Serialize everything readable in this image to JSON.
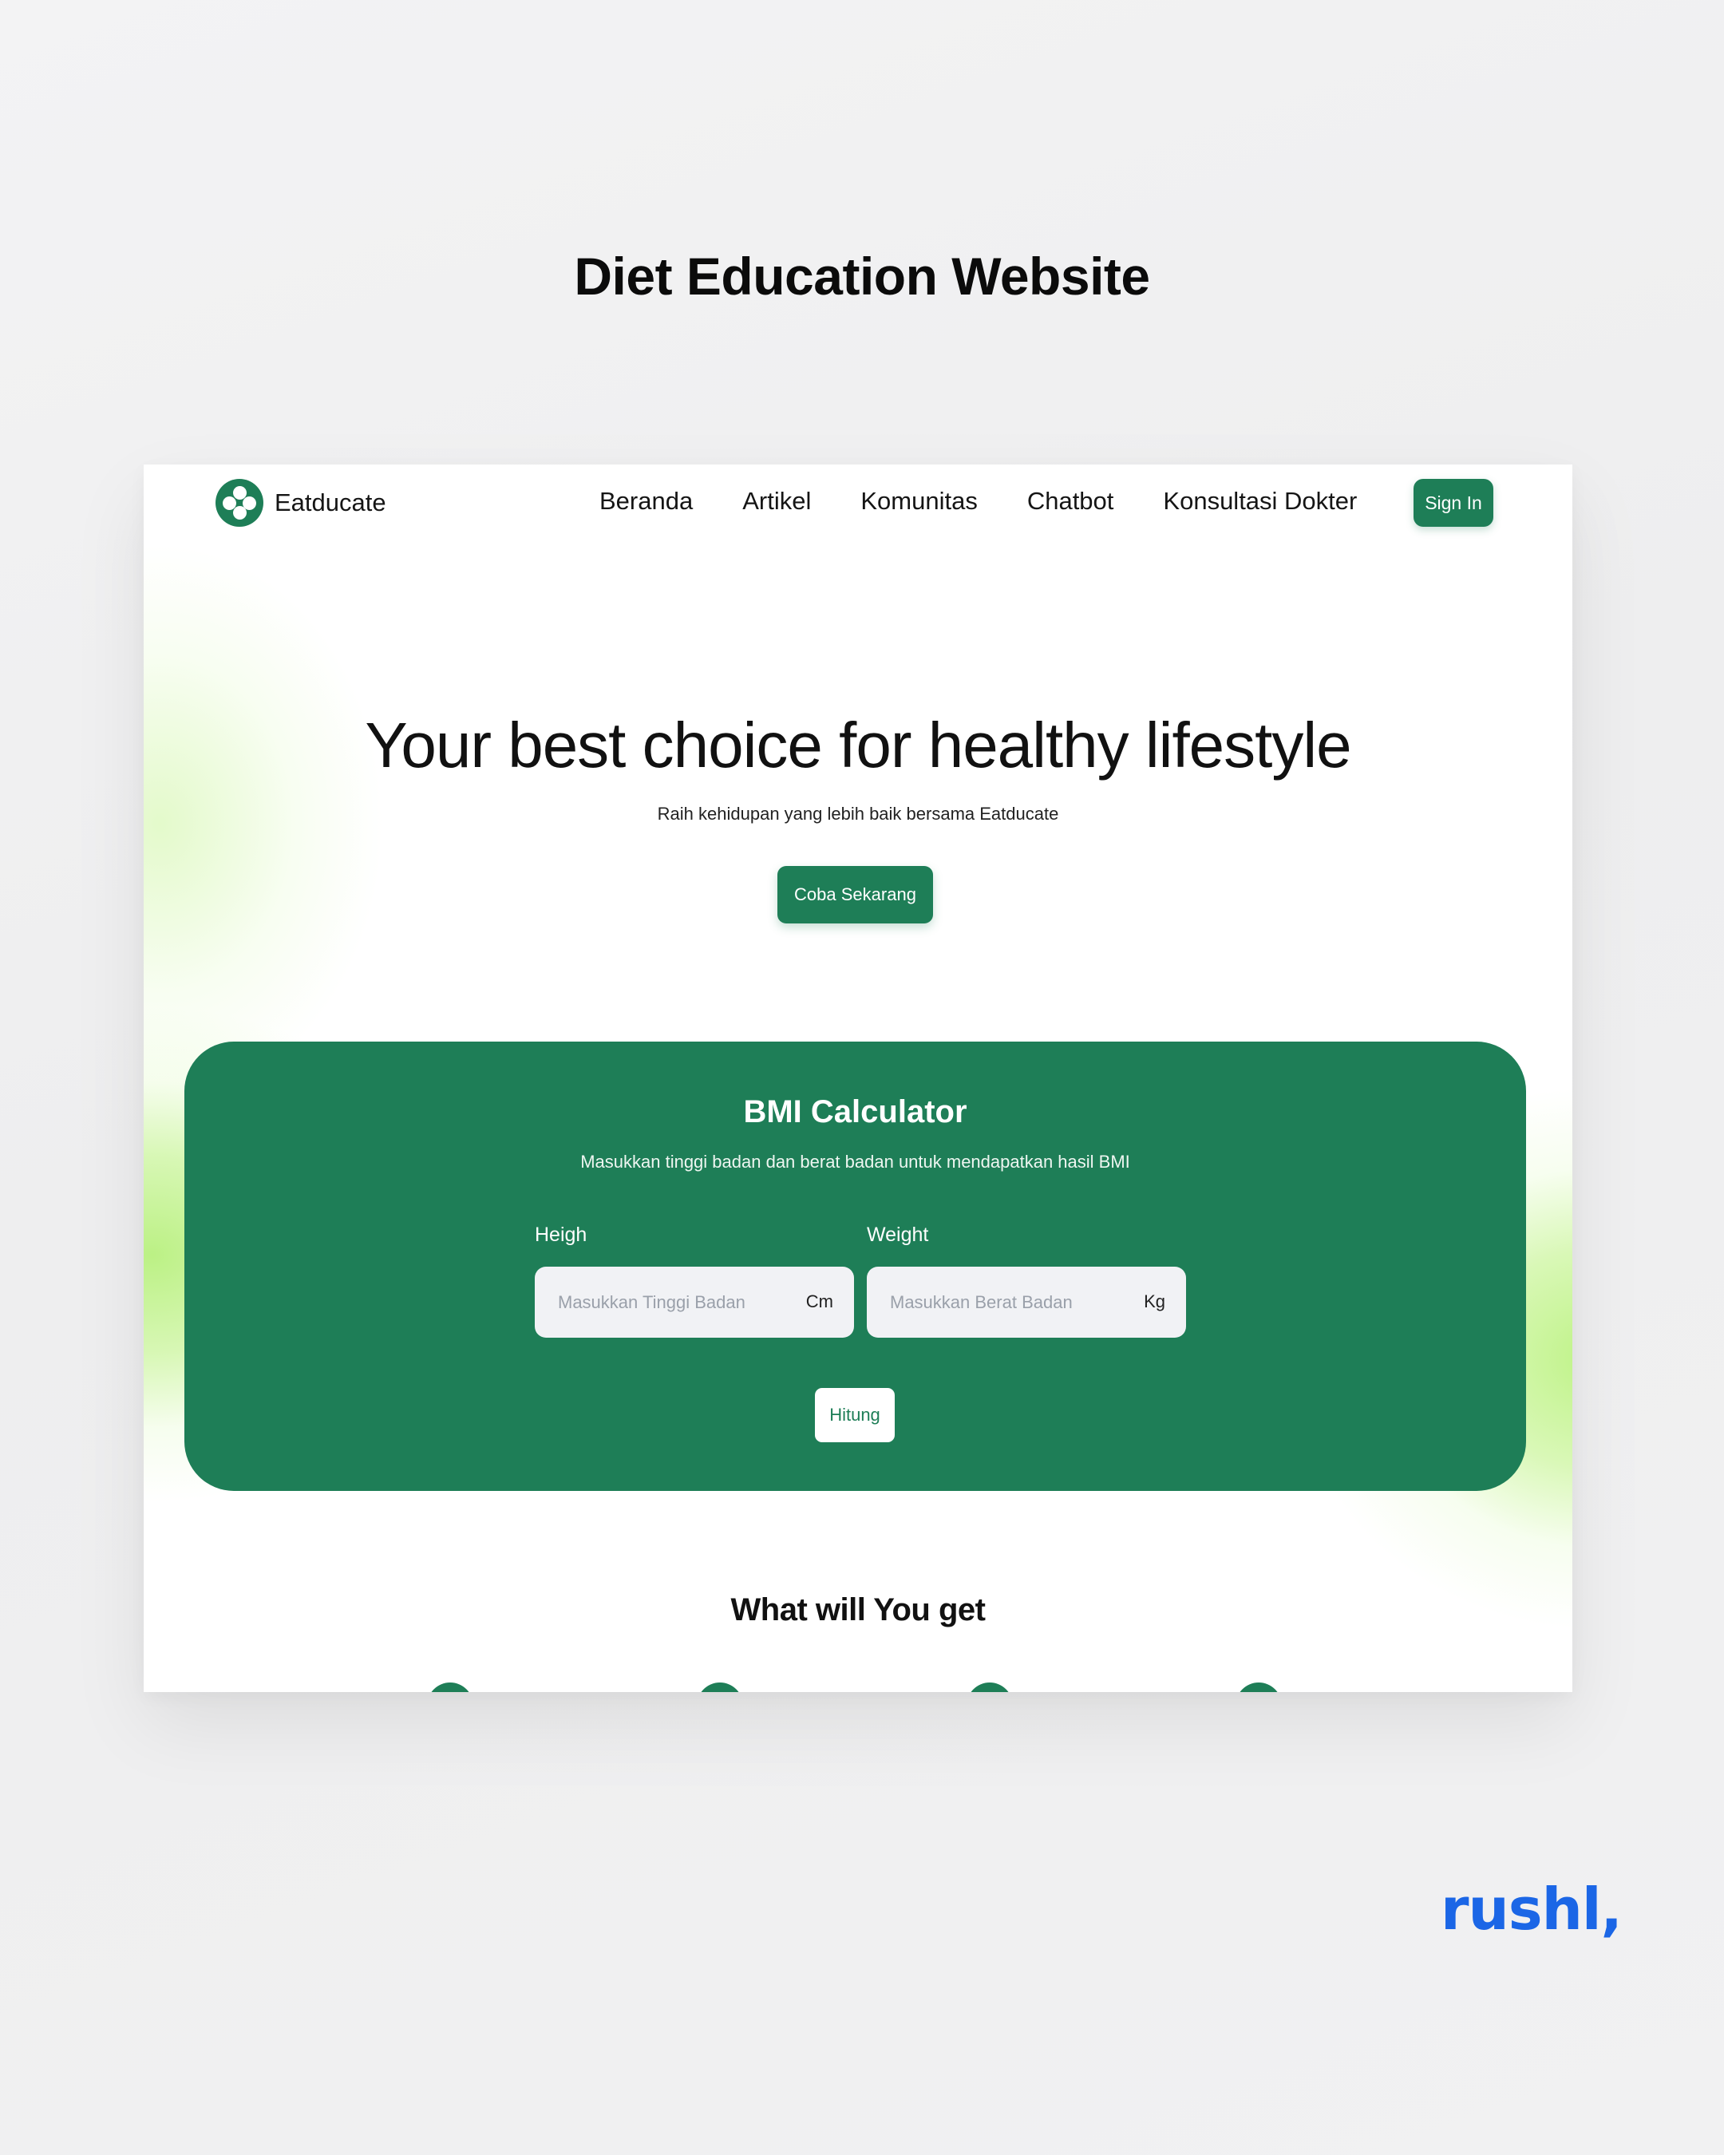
{
  "presentation": {
    "title": "Diet Education Website",
    "signature": "rushl,"
  },
  "navbar": {
    "logo_text": "Eatducate",
    "links": [
      "Beranda",
      "Artikel",
      "Komunitas",
      "Chatbot",
      "Konsultasi Dokter"
    ],
    "signin_label": "Sign In"
  },
  "hero": {
    "title": "Your best choice for healthy lifestyle",
    "subtitle": "Raih kehidupan yang lebih baik bersama Eatducate",
    "cta_label": "Coba Sekarang"
  },
  "bmi": {
    "title": "BMI Calculator",
    "description": "Masukkan tinggi badan dan berat badan untuk mendapatkan hasil BMI",
    "height": {
      "label": "Heigh",
      "placeholder": "Masukkan Tinggi Badan",
      "value": "",
      "unit": "Cm"
    },
    "weight": {
      "label": "Weight",
      "placeholder": "Masukkan Berat Badan",
      "value": "",
      "unit": "Kg"
    },
    "submit_label": "Hitung"
  },
  "features": {
    "title": "What will You get"
  },
  "colors": {
    "brand_green": "#1e7e57",
    "accent_lime": "#c2f28c",
    "signature_blue": "#1b66e6"
  },
  "icons": {
    "logo": "four-dot-flower-icon",
    "features": [
      "feature-icon-1",
      "feature-icon-2",
      "feature-icon-3",
      "feature-icon-4"
    ]
  }
}
